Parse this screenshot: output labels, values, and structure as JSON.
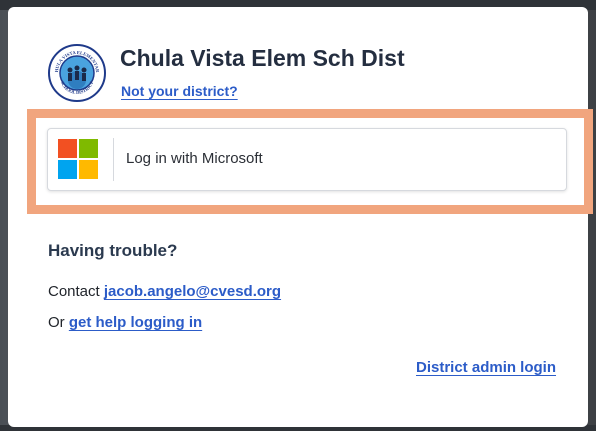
{
  "district": {
    "name": "Chula Vista Elem Sch Dist",
    "not_your_district": "Not your district?",
    "logo_icon": "district-seal-icon",
    "logo_text_top": "CHULA VISTA ELEMENTARY",
    "logo_text_bottom": "SCHOOL DISTRICT"
  },
  "login": {
    "microsoft_label": "Log in with Microsoft",
    "microsoft_icon": "microsoft-logo-icon",
    "highlight_color": "#f1a57e"
  },
  "help": {
    "title": "Having trouble?",
    "contact_prefix": "Contact ",
    "contact_email": "jacob.angelo@cvesd.org",
    "or_prefix": "Or ",
    "help_link": "get help logging in"
  },
  "admin": {
    "link": "District admin login"
  },
  "colors": {
    "link": "#2c5cc8",
    "heading": "#242e40"
  }
}
